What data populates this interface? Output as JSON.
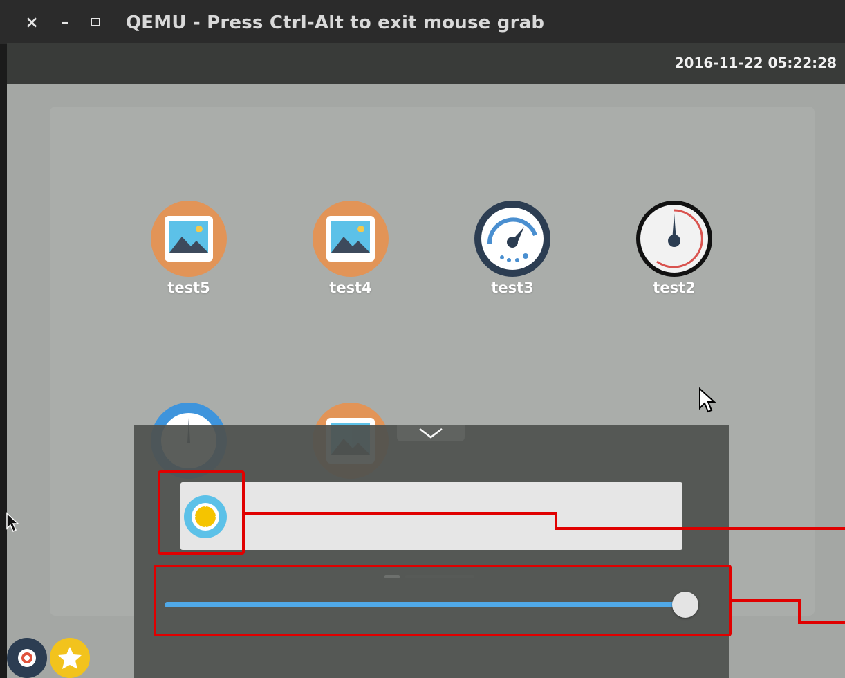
{
  "window": {
    "title": "QEMU - Press Ctrl-Alt to exit mouse grab",
    "controls": {
      "close": "×",
      "minimize": "–",
      "maximize": "▫"
    }
  },
  "top_panel": {
    "clock": "2016-11-22 05:22:28"
  },
  "launcher": {
    "apps": [
      {
        "label": "test5",
        "icon": "image-icon"
      },
      {
        "label": "test4",
        "icon": "image-icon"
      },
      {
        "label": "test3",
        "icon": "speedometer-icon"
      },
      {
        "label": "test2",
        "icon": "gauge-icon"
      },
      {
        "label": "",
        "icon": "gauge-blue-icon"
      },
      {
        "label": "",
        "icon": "image-icon"
      }
    ]
  },
  "control_panel": {
    "brightness_value": 0.97
  },
  "colors": {
    "accent": "#50a9e8",
    "annotation": "#e00000",
    "app_orange": "#e29457"
  }
}
